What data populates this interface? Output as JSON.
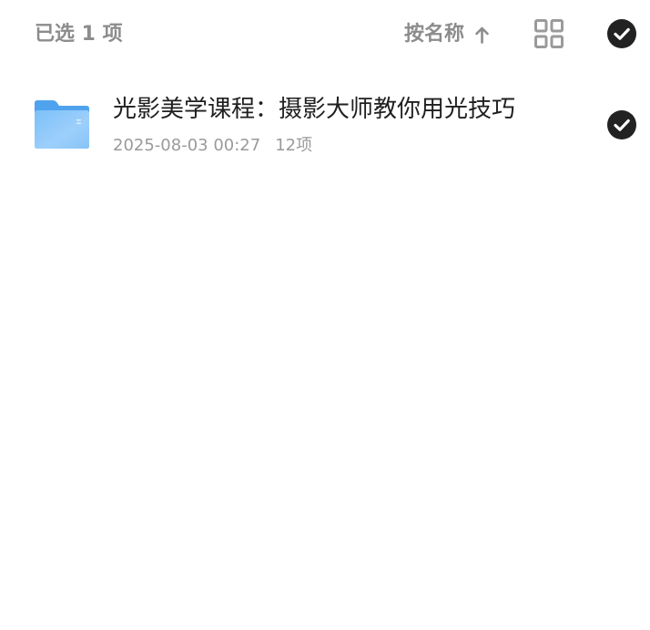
{
  "header": {
    "selection_count": "已选 1 项",
    "sort_label": "按名称",
    "sort_direction_icon": "arrow-up-icon",
    "view_toggle_icon": "grid-view-icon",
    "select_all_icon": "check-circle-icon"
  },
  "files": [
    {
      "name": "光影美学课程：摄影大师教你用光技巧",
      "icon": "folder-icon",
      "modified": "2025-08-03 00:27",
      "count": "12项",
      "selected": true
    }
  ],
  "colors": {
    "muted_text": "#8c8c8c",
    "primary_text": "#1f1f1f",
    "meta_text": "#9a9a9a",
    "check_fill": "#222222",
    "folder_blue": "#5aa9f0"
  }
}
